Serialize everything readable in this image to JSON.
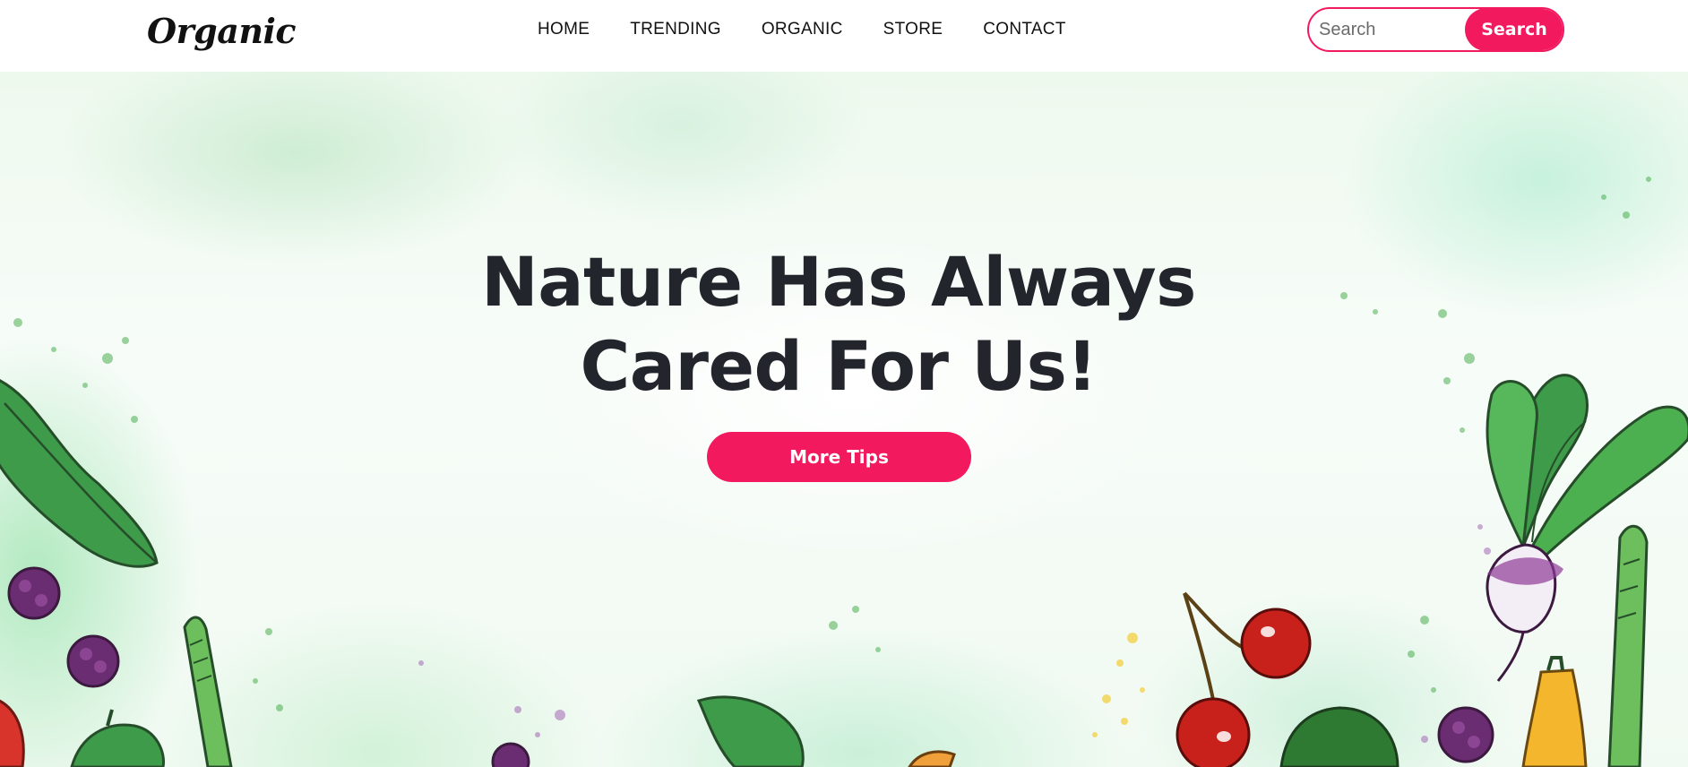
{
  "brand": {
    "name": "Organic"
  },
  "nav": {
    "items": [
      {
        "label": "HOME"
      },
      {
        "label": "TRENDING"
      },
      {
        "label": "ORGANIC"
      },
      {
        "label": "STORE"
      },
      {
        "label": "CONTACT"
      }
    ]
  },
  "search": {
    "placeholder": "Search",
    "value": "",
    "button_label": "Search"
  },
  "hero": {
    "title_line1": "Nature Has Always",
    "title_line2": "Cared For Us!",
    "cta_label": "More Tips"
  },
  "colors": {
    "accent": "#f3195f",
    "text_dark": "#22252b",
    "hero_bg": "#f1faf2"
  },
  "icons": [
    "lettuce-leaf-icon",
    "blackberry-icon",
    "asparagus-icon",
    "bell-pepper-icon",
    "strawberry-icon",
    "cherries-icon",
    "turnip-icon",
    "yellow-pepper-icon",
    "avocado-icon",
    "leaf-icon"
  ]
}
